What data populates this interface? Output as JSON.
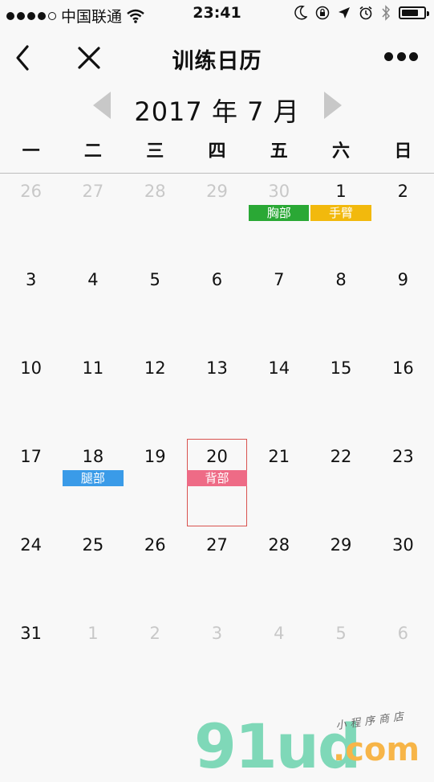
{
  "status_bar": {
    "carrier": "中国联通",
    "time": "23:41"
  },
  "nav": {
    "title": "训练日历"
  },
  "month_header": {
    "label": "2017 年 7 月"
  },
  "weekdays": [
    "一",
    "二",
    "三",
    "四",
    "五",
    "六",
    "日"
  ],
  "weeks": [
    [
      {
        "day": "26",
        "muted": true
      },
      {
        "day": "27",
        "muted": true
      },
      {
        "day": "28",
        "muted": true
      },
      {
        "day": "29",
        "muted": true
      },
      {
        "day": "30",
        "muted": true,
        "tag": "胸部",
        "tag_color": "#2aa835"
      },
      {
        "day": "1",
        "tag": "手臂",
        "tag_color": "#f2b90d"
      },
      {
        "day": "2"
      }
    ],
    [
      {
        "day": "3"
      },
      {
        "day": "4"
      },
      {
        "day": "5"
      },
      {
        "day": "6"
      },
      {
        "day": "7"
      },
      {
        "day": "8"
      },
      {
        "day": "9"
      }
    ],
    [
      {
        "day": "10"
      },
      {
        "day": "11"
      },
      {
        "day": "12"
      },
      {
        "day": "13"
      },
      {
        "day": "14"
      },
      {
        "day": "15"
      },
      {
        "day": "16"
      }
    ],
    [
      {
        "day": "17"
      },
      {
        "day": "18",
        "tag": "腿部",
        "tag_color": "#3a9be8"
      },
      {
        "day": "19"
      },
      {
        "day": "20",
        "today": true,
        "tag": "背部",
        "tag_color": "#ee6b86"
      },
      {
        "day": "21"
      },
      {
        "day": "22"
      },
      {
        "day": "23"
      }
    ],
    [
      {
        "day": "24"
      },
      {
        "day": "25"
      },
      {
        "day": "26"
      },
      {
        "day": "27"
      },
      {
        "day": "28"
      },
      {
        "day": "29"
      },
      {
        "day": "30"
      }
    ],
    [
      {
        "day": "31"
      },
      {
        "day": "1",
        "muted": true
      },
      {
        "day": "2",
        "muted": true
      },
      {
        "day": "3",
        "muted": true
      },
      {
        "day": "4",
        "muted": true
      },
      {
        "day": "5",
        "muted": true
      },
      {
        "day": "6",
        "muted": true
      }
    ]
  ],
  "watermark": {
    "main": "91ud",
    "com": ".com",
    "small": "小程序商店"
  },
  "colors": {
    "today_border": "#d9534f",
    "muted_text": "#c8c8c8",
    "arrow": "#c8c8c8"
  },
  "icons": {
    "back": "chevron-left-icon",
    "close": "close-icon",
    "more": "more-dots-icon",
    "signal": "signal-dots-icon",
    "wifi": "wifi-icon",
    "moon": "moon-icon",
    "rotation_lock": "rotation-lock-icon",
    "location": "location-arrow-icon",
    "alarm": "alarm-icon",
    "bluetooth": "bluetooth-icon",
    "battery": "battery-icon"
  },
  "battery_level": 0.75
}
